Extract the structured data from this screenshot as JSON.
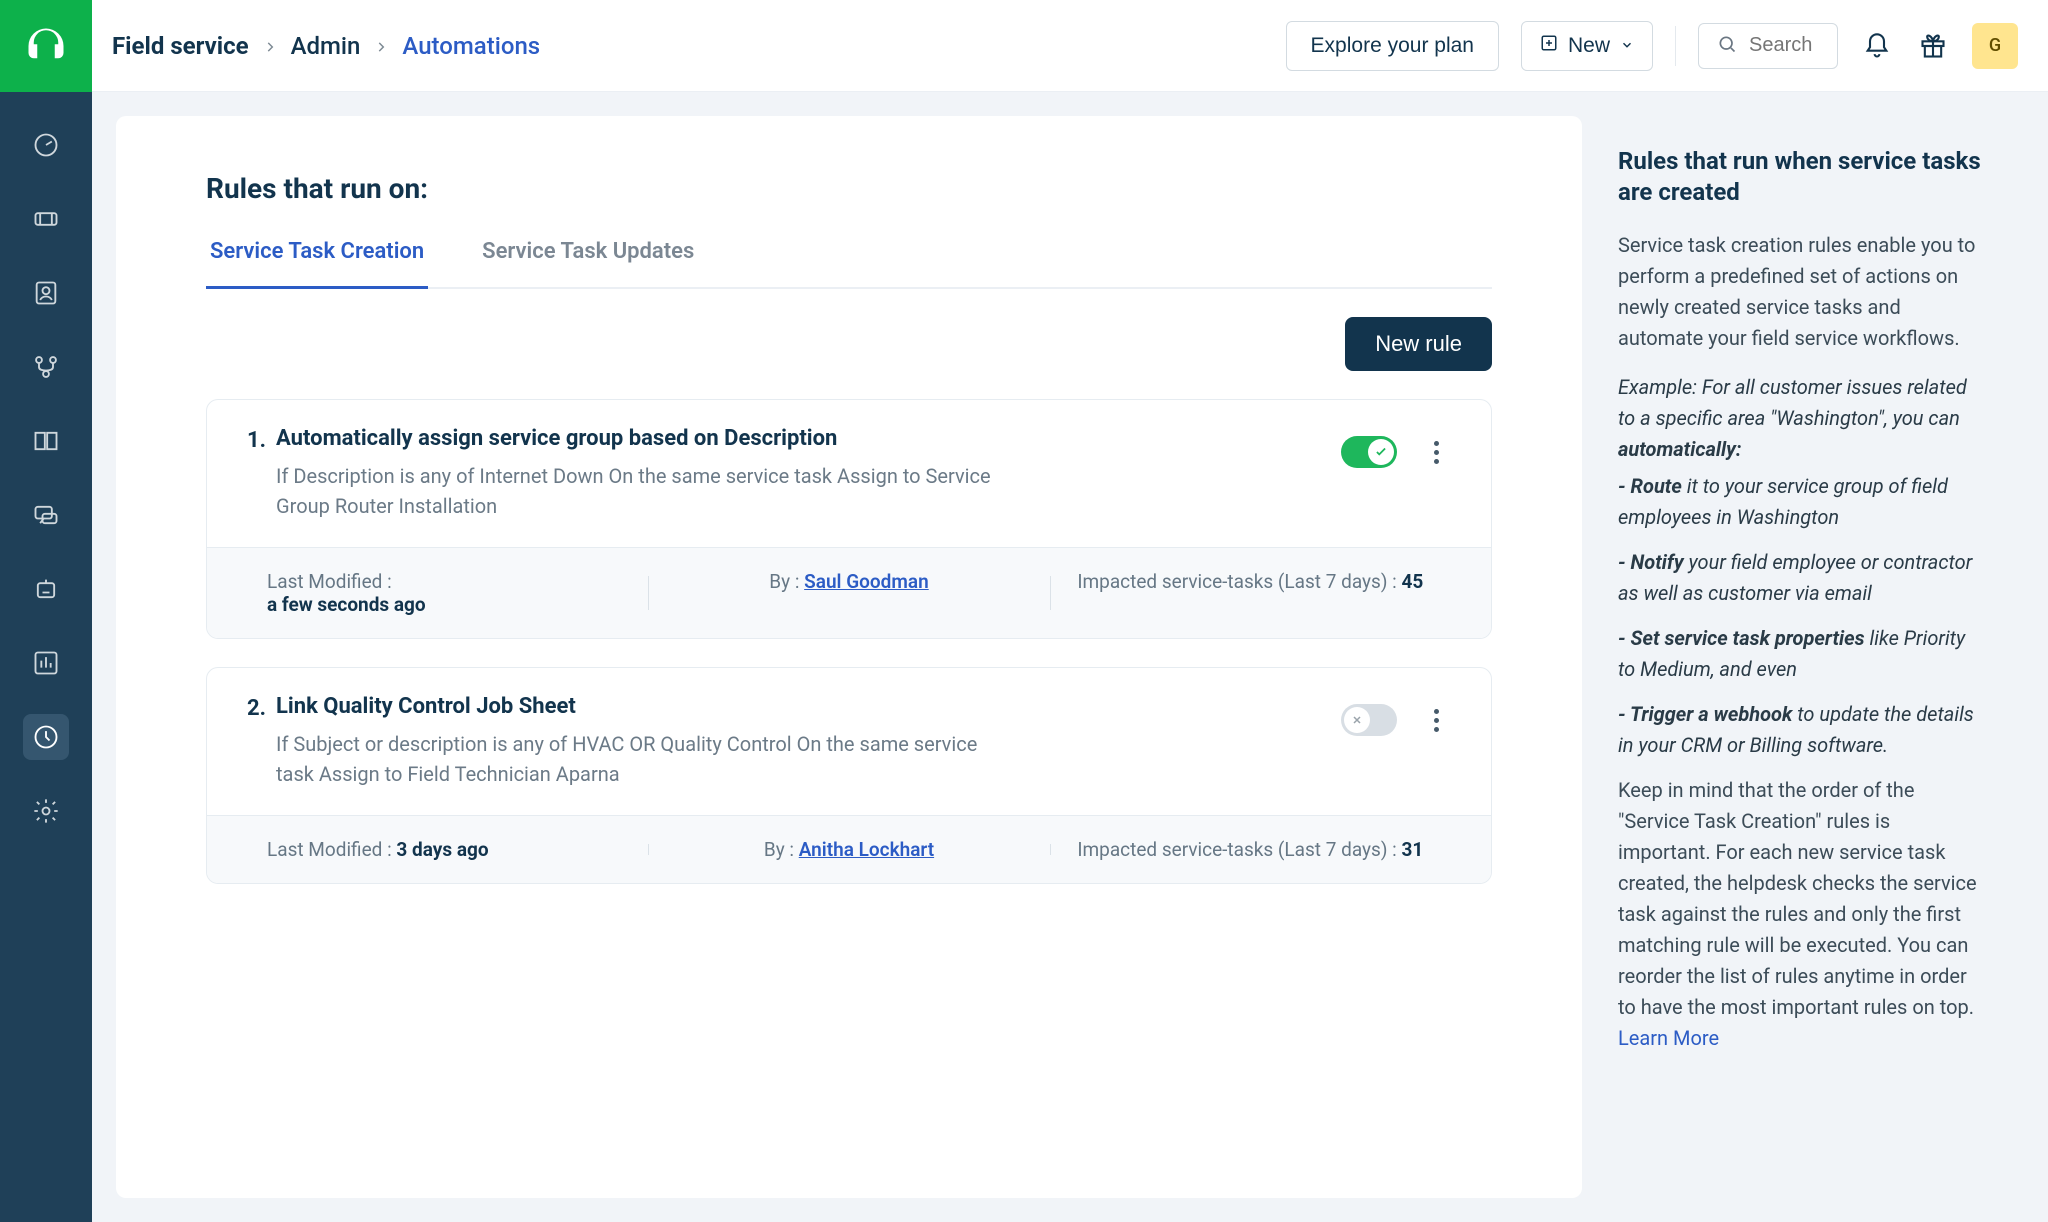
{
  "breadcrumb": {
    "root": "Field service",
    "admin": "Admin",
    "current": "Automations"
  },
  "header": {
    "explore": "Explore your plan",
    "new": "New",
    "search_placeholder": "Search",
    "avatar_initial": "G"
  },
  "page": {
    "title": "Rules that run on:",
    "tabs": [
      {
        "label": "Service Task Creation",
        "active": true
      },
      {
        "label": "Service Task Updates",
        "active": false
      }
    ],
    "new_rule": "New rule"
  },
  "rules": [
    {
      "index": "1.",
      "title": "Automatically assign service group based on Description",
      "desc": "If Description is any of Internet Down On the same service task Assign to Service Group Router Installation",
      "enabled": true,
      "meta": {
        "modified_label": "Last Modified :",
        "modified_value": "a few seconds ago",
        "by_label": "By :",
        "by_value": "Saul Goodman",
        "impacted_label": "Impacted service-tasks (Last 7 days) :",
        "impacted_value": "45"
      }
    },
    {
      "index": "2.",
      "title": "Link Quality Control Job Sheet",
      "desc": "If Subject or description is any of HVAC OR Quality Control On the same service task Assign to Field Technician Aparna",
      "enabled": false,
      "meta": {
        "modified_label": "Last Modified :",
        "modified_value": "3 days ago",
        "by_label": "By :",
        "by_value": "Anitha Lockhart",
        "impacted_label": "Impacted service-tasks (Last 7 days) :",
        "impacted_value": "31"
      }
    }
  ],
  "help": {
    "title": "Rules that run when service tasks are created",
    "intro": "Service task creation rules enable you to perform a predefined set of actions on newly created service tasks and automate your field service workflows.",
    "example_prefix": "Example: For all customer issues related to a specific area \"Washington\", you can ",
    "example_strong": "automatically:",
    "bullets": [
      {
        "strong": "- Route",
        "rest": " it to your service group of field employees in Washington"
      },
      {
        "strong": "- Notify",
        "rest": " your field employee or contractor as well as customer via email"
      },
      {
        "strong": "- Set service task properties",
        "rest": " like Priority to Medium, and even"
      },
      {
        "strong": "- Trigger a webhook",
        "rest": " to update the details in your CRM or Billing software."
      }
    ],
    "footer": "Keep in mind that the order of the \"Service Task Creation\" rules is important. For each new service task created, the helpdesk checks the service task against the rules and only the first matching rule will be executed. You can reorder the list of rules anytime in order to have the most important rules on top.",
    "learn_more": "Learn More"
  }
}
